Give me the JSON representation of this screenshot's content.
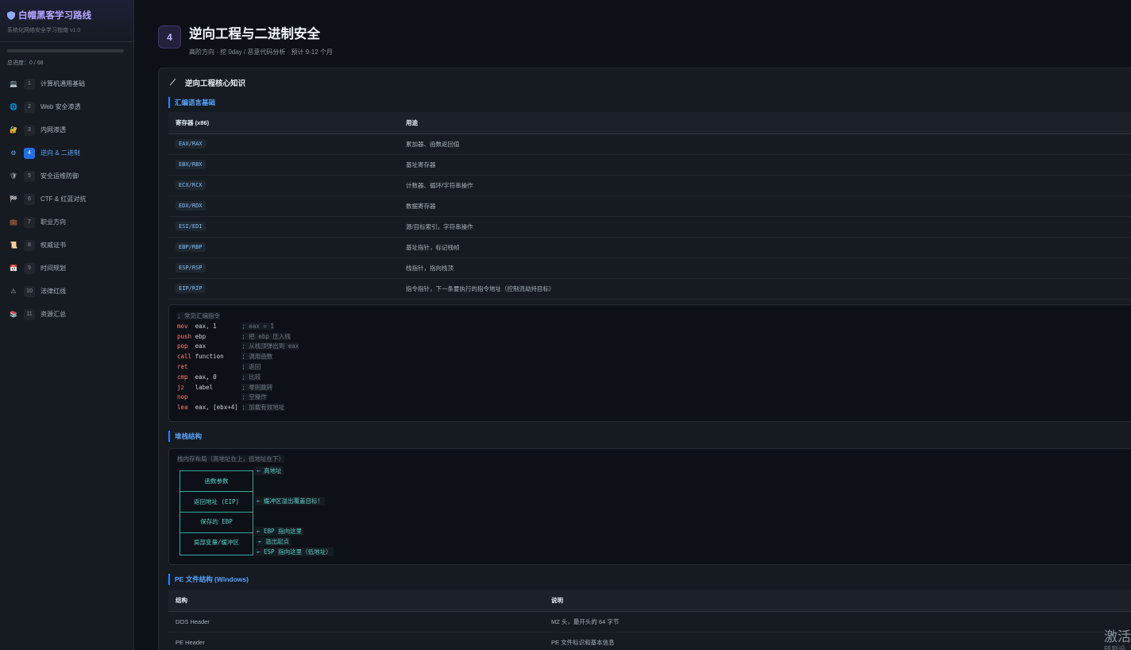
{
  "sidebar": {
    "title": "白帽黑客学习路线",
    "subtitle": "系统化网络安全学习指南 v1.0",
    "progress_label": "总进度：0 / 68",
    "progress_value": 0,
    "items": [
      {
        "icon": "laptop-icon",
        "glyph": "💻",
        "num": "1",
        "label": "计算机通用基础"
      },
      {
        "icon": "globe-icon",
        "glyph": "🌐",
        "num": "2",
        "label": "Web 安全渗透"
      },
      {
        "icon": "lock-icon",
        "glyph": "🔐",
        "num": "3",
        "label": "内网渗透"
      },
      {
        "icon": "gear-icon",
        "glyph": "⚙",
        "num": "4",
        "label": "逆向 & 二进制"
      },
      {
        "icon": "shield-icon",
        "glyph": "🛡",
        "num": "5",
        "label": "安全运维防御"
      },
      {
        "icon": "flag-icon",
        "glyph": "🏁",
        "num": "6",
        "label": "CTF & 红蓝对抗"
      },
      {
        "icon": "briefcase-icon",
        "glyph": "💼",
        "num": "7",
        "label": "职业方向"
      },
      {
        "icon": "scroll-icon",
        "glyph": "📜",
        "num": "8",
        "label": "权威证书"
      },
      {
        "icon": "calendar-icon",
        "glyph": "📅",
        "num": "9",
        "label": "时间规划"
      },
      {
        "icon": "warning-icon",
        "glyph": "⚠",
        "num": "10",
        "label": "法律红线"
      },
      {
        "icon": "books-icon",
        "glyph": "📚",
        "num": "11",
        "label": "资源汇总"
      }
    ]
  },
  "header": {
    "badge": "4",
    "title": "逆向工程与二进制安全",
    "subtitle": "高阶方向 · 挖 0day / 恶意代码分析 · 预计 9-12 个月"
  },
  "card": {
    "title": "逆向工程核心知识",
    "asm_section": "汇编语言基础",
    "reg_table": {
      "headers": [
        "寄存器 (x86)",
        "用途"
      ],
      "rows": [
        [
          "EAX/RAX",
          "累加器、函数返回值"
        ],
        [
          "EBX/RBX",
          "基址寄存器"
        ],
        [
          "ECX/RCX",
          "计数器、循环/字符串操作"
        ],
        [
          "EDX/RDX",
          "数据寄存器"
        ],
        [
          "ESI/EDI",
          "源/目标索引，字符串操作"
        ],
        [
          "EBP/RBP",
          "基址指针，标记栈帧"
        ],
        [
          "ESP/RSP",
          "栈指针，指向栈顶"
        ],
        [
          "EIP/RIP",
          "指令指针，下一条要执行的指令地址（控制流劫持目标）"
        ]
      ]
    },
    "asm_code": [
      {
        "kw": "",
        "args": "",
        "comment": "; 常见汇编指令"
      },
      {
        "kw": "mov",
        "args": "  eax, 1       ",
        "comment": "; eax = 1"
      },
      {
        "kw": "push",
        "args": " ebp          ",
        "comment": "; 把 ebp 压入栈"
      },
      {
        "kw": "pop",
        "args": "  eax          ",
        "comment": "; 从栈顶弹出到 eax"
      },
      {
        "kw": "call",
        "args": " function     ",
        "comment": "; 调用函数"
      },
      {
        "kw": "ret",
        "args": "               ",
        "comment": "; 返回"
      },
      {
        "kw": "cmp",
        "args": "  eax, 0       ",
        "comment": "; 比较"
      },
      {
        "kw": "jz",
        "args": "   label        ",
        "comment": "; 零则跳转"
      },
      {
        "kw": "nop",
        "args": "               ",
        "comment": "; 空操作"
      },
      {
        "kw": "lea",
        "args": "  eax, [ebx+4] ",
        "comment": "; 加载有效地址"
      }
    ],
    "stack_section": "堆栈结构",
    "stack": {
      "caption": "栈内存布局（高地址在上，低地址在下）",
      "cells": [
        "函数参数",
        "返回地址 (EIP)",
        "保存的 EBP",
        "局部变量/缓冲区"
      ],
      "notes": [
        "← 高地址",
        "← 缓冲区溢出覆盖目标！",
        "← EBP 指向这里",
        "← 溢出起点",
        "← ESP 指向这里（低地址）"
      ]
    },
    "pe_section": "PE 文件结构 (Windows)",
    "pe_table": {
      "headers": [
        "结构",
        "说明"
      ],
      "rows": [
        [
          "DOS Header",
          "MZ 头，最开头的 64 字节"
        ],
        [
          "PE Header",
          "PE 文件标识和基本信息"
        ]
      ]
    }
  },
  "watermark": {
    "line1": "激活",
    "line2": "转到设"
  }
}
